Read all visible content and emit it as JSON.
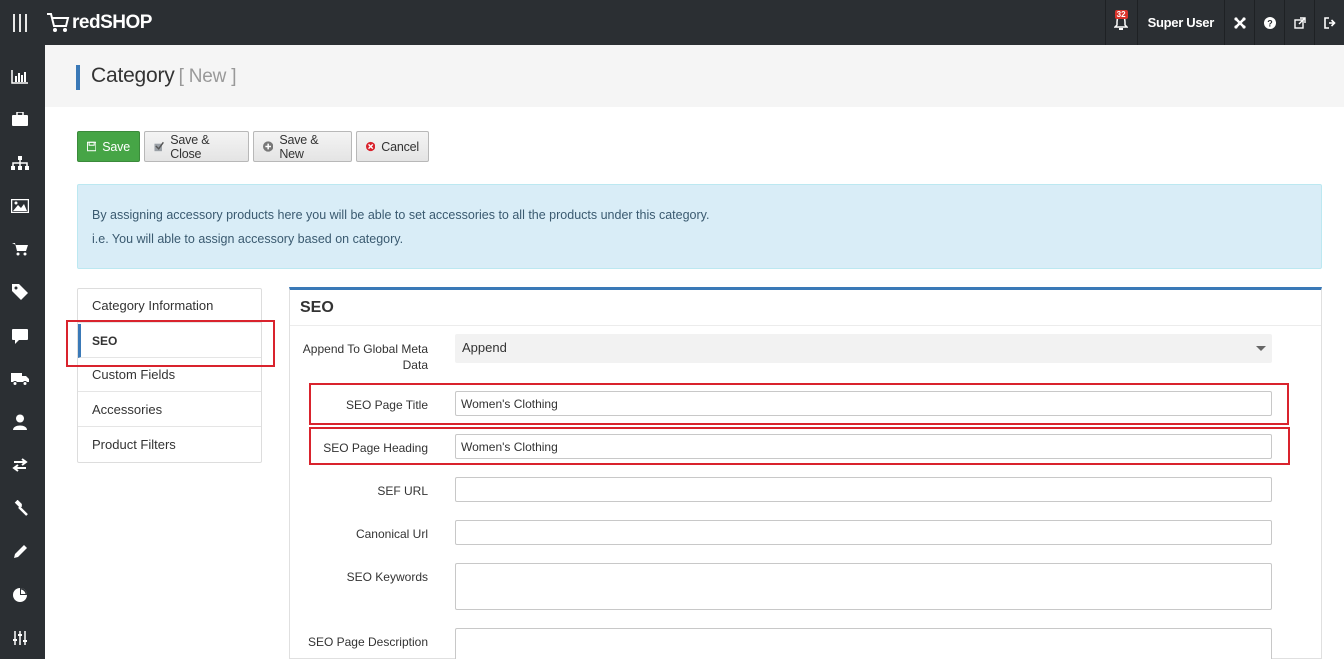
{
  "app": {
    "name": "redSHOP"
  },
  "topbar": {
    "notification_count": "32",
    "user_name": "Super User",
    "icons": [
      "bell-icon",
      "joomla-icon",
      "help-icon",
      "external-link-icon",
      "logout-icon"
    ]
  },
  "sidebar": {
    "icons": [
      "dashboard-icon",
      "briefcase-icon",
      "sitemap-icon",
      "image-icon",
      "cart-icon",
      "tag-icon",
      "comment-icon",
      "truck-icon",
      "user-icon",
      "exchange-icon",
      "hammer-icon",
      "pencil-icon",
      "pie-chart-icon",
      "sliders-icon"
    ]
  },
  "page": {
    "title": "Category",
    "subtitle": "[ New ]"
  },
  "toolbar": {
    "save": "Save",
    "save_close": "Save & Close",
    "save_new": "Save & New",
    "cancel": "Cancel"
  },
  "alert": {
    "line1": "By assigning accessory products here you will be able to set accessories to all the products under this category.",
    "line2": "i.e. You will able to assign accessory based on category."
  },
  "tabs": [
    {
      "label": "Category Information"
    },
    {
      "label": "SEO"
    },
    {
      "label": "Custom Fields"
    },
    {
      "label": "Accessories"
    },
    {
      "label": "Product Filters"
    }
  ],
  "seo": {
    "title": "SEO",
    "append_label": "Append To Global Meta Data",
    "append_value": "Append",
    "page_title_label": "SEO Page Title",
    "page_title_value": "Women's Clothing",
    "page_heading_label": "SEO Page Heading",
    "page_heading_value": "Women's Clothing",
    "sef_url_label": "SEF URL",
    "sef_url_value": "",
    "canonical_label": "Canonical Url",
    "canonical_value": "",
    "keywords_label": "SEO Keywords",
    "keywords_value": "",
    "description_label": "SEO Page Description",
    "description_value": ""
  },
  "colors": {
    "accent": "#3a79b7",
    "save_button": "#46a546",
    "highlight": "#d9232d",
    "alert_bg": "#d9edf7",
    "topbar": "#2b2f33"
  }
}
